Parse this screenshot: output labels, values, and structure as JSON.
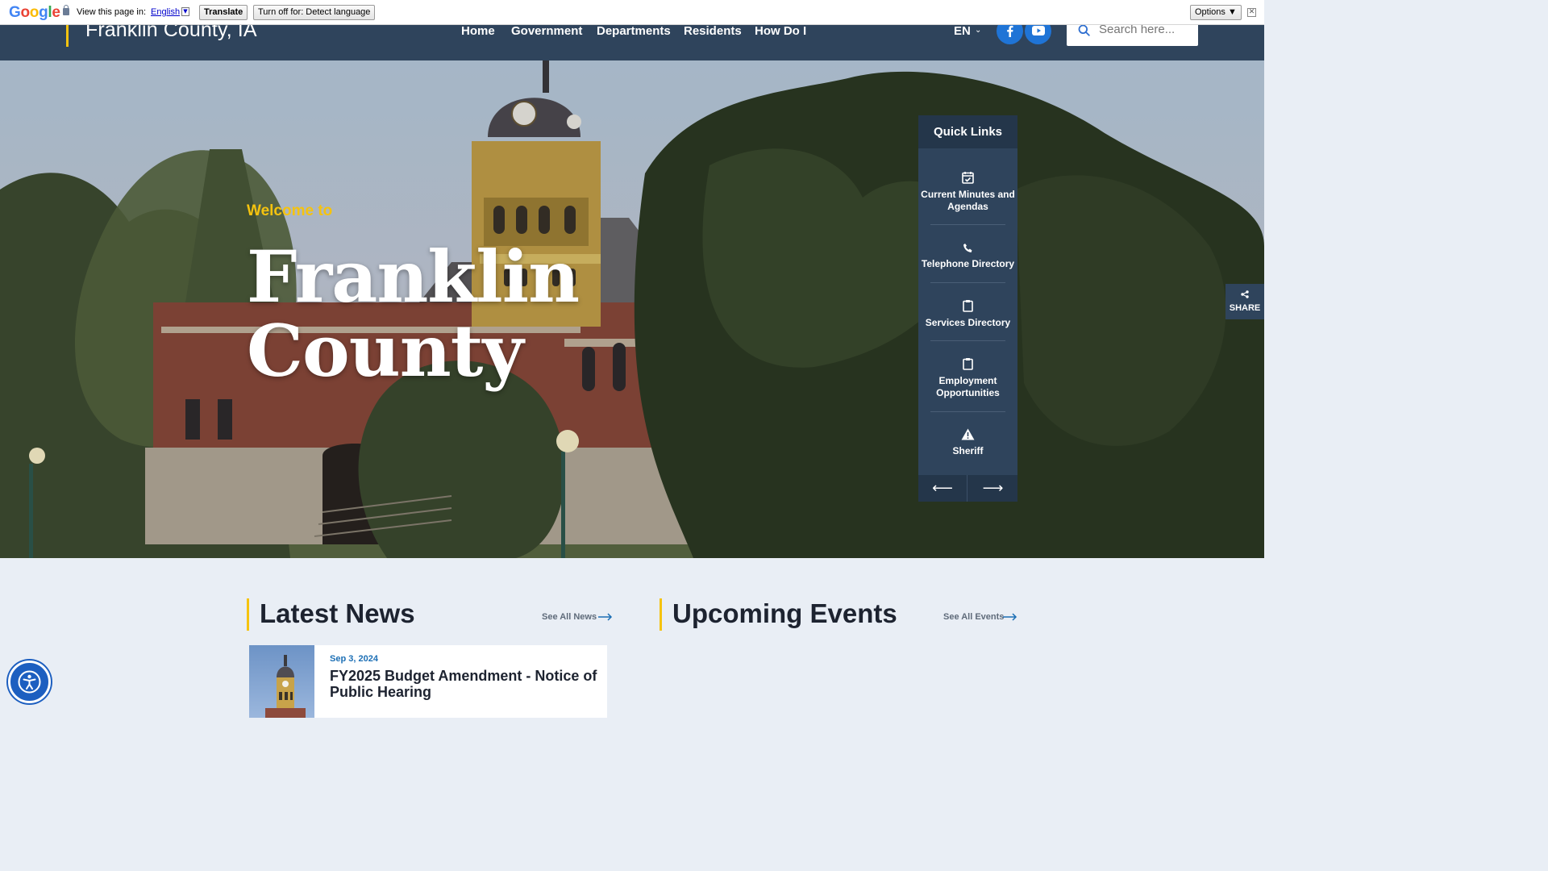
{
  "translate_bar": {
    "logo": "Google",
    "prompt": "View this page in:",
    "language": "English",
    "translate_button": "Translate",
    "turn_off_button": "Turn off for: Detect language",
    "options_button": "Options ▼",
    "close": "✕"
  },
  "header": {
    "site_title": "Franklin County, IA",
    "nav": [
      "Home",
      "Government",
      "Departments",
      "Residents",
      "How Do I"
    ],
    "language": "EN",
    "language_chevron": "chevron-down-icon",
    "social": [
      "facebook-icon",
      "youtube-icon"
    ],
    "search_placeholder": "Search here..."
  },
  "hero": {
    "welcome": "Welcome to",
    "title": "Franklin County"
  },
  "quick_links": {
    "heading": "Quick Links",
    "items": [
      {
        "label": "Current Minutes and Agendas",
        "icon": "calendar-check-icon"
      },
      {
        "label": "Telephone Directory",
        "icon": "phone-icon"
      },
      {
        "label": "Services Directory",
        "icon": "clipboard-icon"
      },
      {
        "label": "Employment Opportunities",
        "icon": "clipboard-icon"
      },
      {
        "label": "Sheriff",
        "icon": "warning-icon"
      }
    ],
    "prev": "⟵",
    "next": "⟶"
  },
  "share": {
    "label": "SHARE"
  },
  "news": {
    "heading": "Latest News",
    "see_all": "See All News",
    "items": [
      {
        "date": "Sep 3, 2024",
        "title": "FY2025 Budget Amendment - Notice of Public Hearing"
      }
    ]
  },
  "events": {
    "heading": "Upcoming Events",
    "see_all": "See All Events"
  },
  "colors": {
    "header": "#2f445c",
    "accent": "#f5c30f",
    "link": "#1c6fb5",
    "social": "#1f74d6"
  }
}
